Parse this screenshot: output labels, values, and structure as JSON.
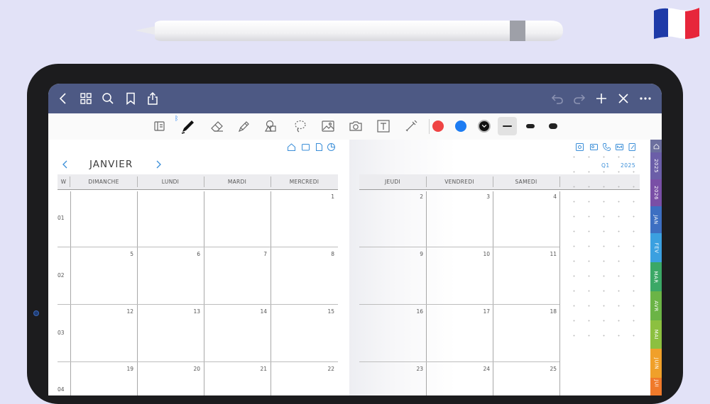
{
  "toolbar": {
    "bluetooth_glyph": "ᛒ",
    "colors": [
      "#ef4444",
      "#1d7cf2",
      "#111111"
    ]
  },
  "calendar": {
    "month": "JANVIER",
    "left_headers": [
      "W",
      "DIMANCHE",
      "LUNDI",
      "MARDI",
      "MERCREDI"
    ],
    "right_headers": [
      "JEUDI",
      "VENDREDI",
      "SAMEDI"
    ],
    "weeks": [
      "01",
      "02",
      "03",
      "04"
    ],
    "left_days": [
      [
        "",
        "",
        "",
        "1"
      ],
      [
        "5",
        "6",
        "7",
        "8"
      ],
      [
        "12",
        "13",
        "14",
        "15"
      ],
      [
        "19",
        "20",
        "21",
        "22"
      ]
    ],
    "right_days": [
      [
        "2",
        "3",
        "4"
      ],
      [
        "9",
        "10",
        "11"
      ],
      [
        "16",
        "17",
        "18"
      ],
      [
        "23",
        "24",
        "25"
      ]
    ],
    "quarter_label": "Q1",
    "year_label": "2025"
  },
  "side_tabs": [
    {
      "label": "",
      "color": "#6c6f9e",
      "icon": "home-icon"
    },
    {
      "label": "2025",
      "color": "#6b5ea8"
    },
    {
      "label": "2026",
      "color": "#7a4fa6"
    },
    {
      "label": "JAN",
      "color": "#3d6fc2"
    },
    {
      "label": "FEV",
      "color": "#3ba0e0"
    },
    {
      "label": "MAR",
      "color": "#3ba866"
    },
    {
      "label": "AVR",
      "color": "#6bb446"
    },
    {
      "label": "MAI",
      "color": "#8cc040"
    },
    {
      "label": "JUIN",
      "color": "#f0a02a"
    },
    {
      "label": "JUI",
      "color": "#f07a2a"
    }
  ]
}
